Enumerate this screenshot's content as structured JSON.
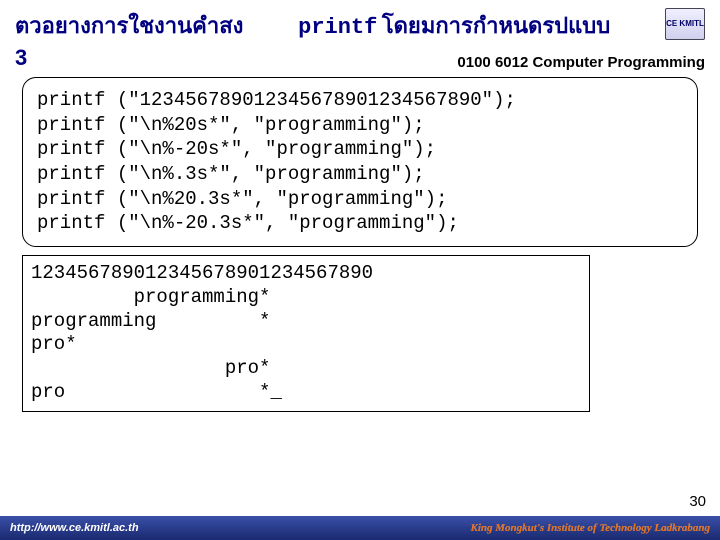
{
  "header": {
    "title_left": "ตวอยางการใชงานคำสง",
    "title_printf": "printf",
    "title_right": "โดยมการกำหนดรปแบบ",
    "course": "0100 6012 Computer Programming",
    "three": "3",
    "logo_text": "CE\nKMITL"
  },
  "code": {
    "l1": "printf (\"123456789012345678901234567890\");",
    "l2": "printf (\"\\n%20s*\", \"programming\");",
    "l3": "printf (\"\\n%-20s*\", \"programming\");",
    "l4": "printf (\"\\n%.3s*\", \"programming\");",
    "l5": "printf (\"\\n%20.3s*\", \"programming\");",
    "l6": "printf (\"\\n%-20.3s*\", \"programming\");"
  },
  "output": {
    "l1": "123456789012345678901234567890",
    "l2": "         programming*",
    "l3": "programming         *",
    "l4": "pro*",
    "l5": "                 pro*",
    "l6": "pro                 *_"
  },
  "page_number": "30",
  "footer": {
    "left": "http://www.ce.kmitl.ac.th",
    "right": "King Mongkut's Institute of Technology Ladkrabang"
  }
}
